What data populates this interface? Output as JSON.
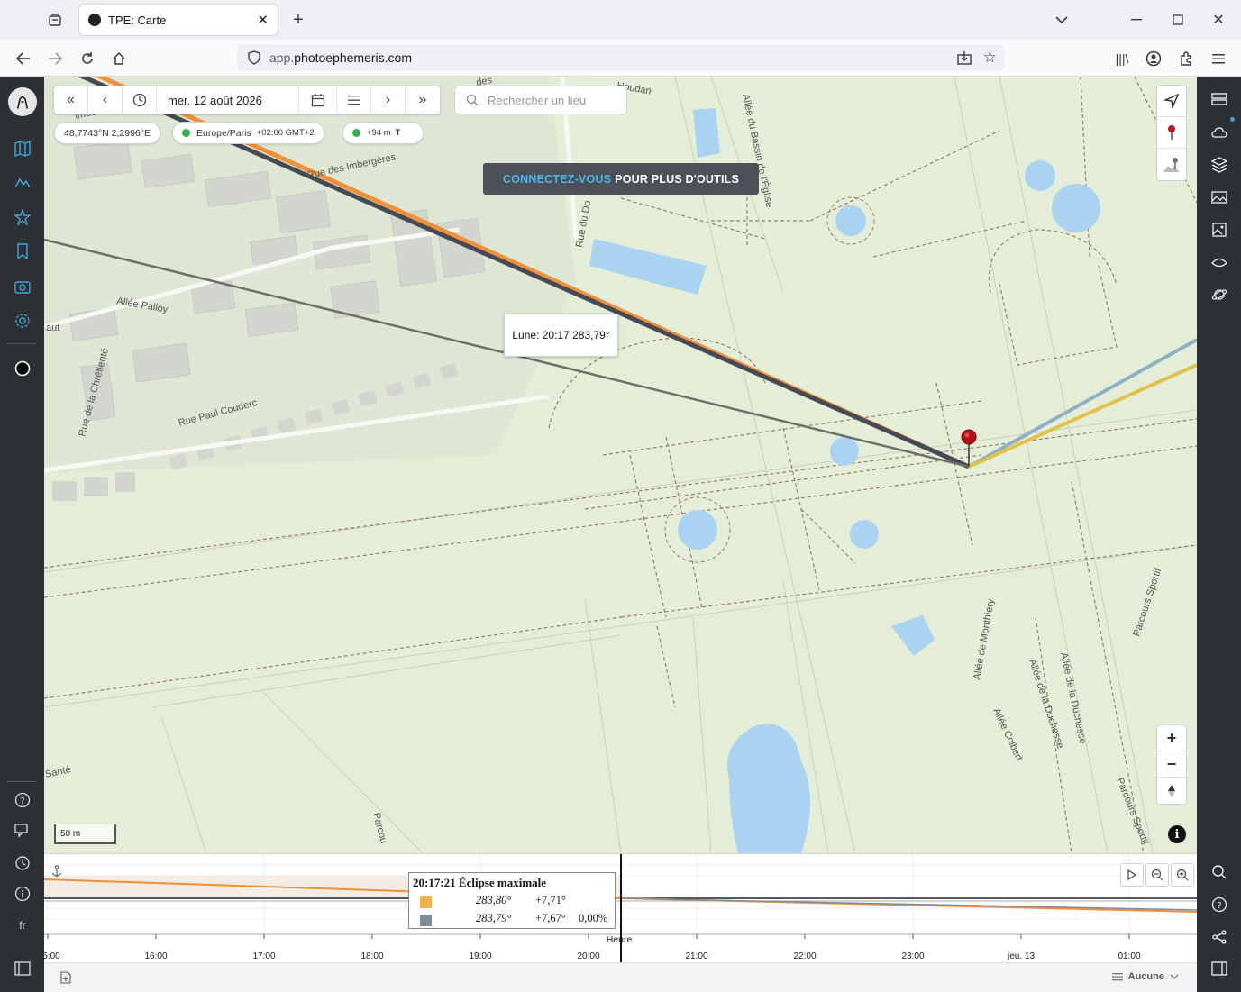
{
  "browser": {
    "tab_title": "TPE: Carte",
    "url_sub": "app.",
    "url_host": "photoephemeris.com"
  },
  "toolbar": {
    "date": "mer. 12 août 2026",
    "search_placeholder": "Rechercher un lieu"
  },
  "info_pills": {
    "coords": "48,7743°N 2,2996°E",
    "timezone": "Europe/Paris",
    "tz_offset": "+02:00 GMT+2",
    "elevation": "+94 m",
    "elev_suffix": "T"
  },
  "banner": {
    "highlight": "CONNECTEZ-VOUS",
    "rest": "POUR PLUS D'OUTILS"
  },
  "map_tooltip": "Lune: 20:17 283,79°",
  "map_labels": {
    "rue_imbergeres": "Rue des Imbergères",
    "allee_palloy": "Allée Palloy",
    "rue_chretiente": "Rue de la Chrétienté",
    "rue_couderc": "Rue Paul Couderc",
    "allee_bassin": "Allée du Bassin de l'Église",
    "houdan": "Houdan",
    "rue_do": "Rue du Do",
    "allee_monthiery": "Allée de Monthiery",
    "allee_duchesse1": "Allée de la Duchesse",
    "allee_duchesse2": "Allée de la Duchesse",
    "allee_colbert": "Allée Colbert",
    "parcours1": "Parcours Sportif",
    "parcours2": "Parcours Sportif",
    "sante": "Santé",
    "aut": "aut",
    "des": "des",
    "imbe": "imbe",
    "parcou": "Parcou"
  },
  "scale_label": "50 m",
  "timeline": {
    "eclipse_title": "20:17:21 Éclipse maximale",
    "rows": [
      {
        "az": "283,80°",
        "alt": "+7,71°",
        "extra": "",
        "color": "#f0b24a"
      },
      {
        "az": "283,79°",
        "alt": "+7,67°",
        "extra": "0,00%",
        "color": "#7f8d99"
      }
    ],
    "axis_label": "Heure",
    "ticks": [
      "5:00",
      "16:00",
      "17:00",
      "18:00",
      "19:00",
      "20:00",
      "21:00",
      "22:00",
      "23:00",
      "jeu. 13",
      "01:00"
    ]
  },
  "statusbar": {
    "right_label": "Aucune"
  },
  "leftbar": {
    "lang": "fr"
  },
  "colors": {
    "sidebar": "#2d3136",
    "accent": "#4bb6e6",
    "sun_line": "#f0913a",
    "moon_line": "#454a55",
    "moonset_line": "#8fb0c4",
    "sunset_line": "#e3c04a",
    "map_bg": "#e4edd8",
    "water": "#aad3f2"
  }
}
